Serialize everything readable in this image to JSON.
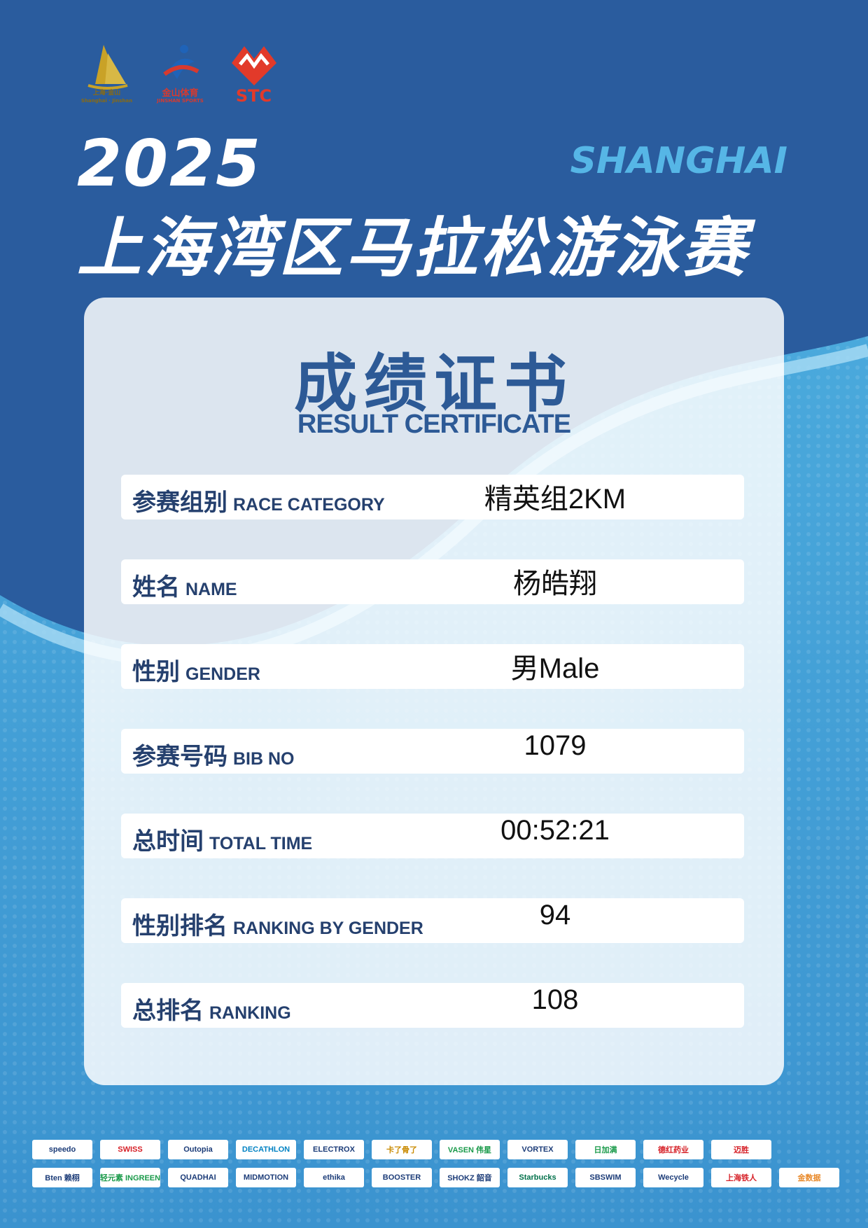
{
  "logos": [
    {
      "name": "shanghai-jinshan-logo",
      "caption": "上海·金山",
      "caption2": "Shanghai · Jinshan",
      "color": "#c9a227"
    },
    {
      "name": "jinshan-sports-logo",
      "caption": "金山体育",
      "caption2": "JINSHAN SPORTS",
      "color": "#d63a2f"
    },
    {
      "name": "stc-logo",
      "caption": "STC",
      "caption2": "",
      "color": "#e23a2a"
    }
  ],
  "header": {
    "year": "2025",
    "city": "SHANGHAI",
    "event_title": "上海湾区马拉松游泳赛"
  },
  "certificate": {
    "title_cn": "成绩证书",
    "title_en": "RESULT CERTIFICATE",
    "rows": [
      {
        "label_cn": "参赛组别",
        "label_en": "RACE CATEGORY",
        "value": "精英组2KM"
      },
      {
        "label_cn": "姓名",
        "label_en": "NAME",
        "value": "杨皓翔"
      },
      {
        "label_cn": "性别",
        "label_en": "GENDER",
        "value": "男Male"
      },
      {
        "label_cn": "参赛号码",
        "label_en": "BIB NO",
        "value": "1079"
      },
      {
        "label_cn": "总时间",
        "label_en": "TOTAL TIME",
        "value": "00:52:21"
      },
      {
        "label_cn": "性别排名",
        "label_en": "RANKING BY GENDER",
        "value": "94"
      },
      {
        "label_cn": "总排名",
        "label_en": "RANKING",
        "value": "108"
      }
    ]
  },
  "sponsors": {
    "row1": [
      "speedo",
      "SWISS",
      "Outopia",
      "DECATHLON",
      "ELECTROX",
      "卡了骨了",
      "VASEN 伟星",
      "VORTEX",
      "日加满",
      "德红药业",
      "迈胜"
    ],
    "row2": [
      "Bten 赖栩",
      "轻元素 INGREEN",
      "QUADHAI",
      "MIDMOTION",
      "ethika",
      "BOOSTER",
      "SHOKZ 韶音",
      "Starbucks",
      "SBSWIM",
      "Wecycle",
      "上海铁人",
      "金数据"
    ]
  },
  "colors": {
    "background": "#2a5c9e",
    "accent": "#56b6e6",
    "primary_text": "#2d5a96"
  }
}
